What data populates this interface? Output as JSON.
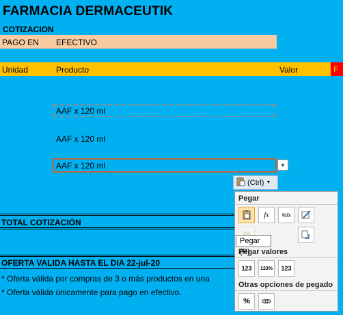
{
  "sheet": {
    "title": "FARMACIA DERMACEUTIK",
    "subtitle": "COTIZACION",
    "payment_label": "PAGO EN",
    "payment_value": "EFECTIVO",
    "headers": {
      "unit": "Unidad",
      "product": "Producto",
      "value": "Valor",
      "extra": "F"
    },
    "rows": [
      {
        "product": "AAF x 120 ml"
      },
      {
        "product": "AAF x 120 ml"
      },
      {
        "product": "AAF x 120 ml"
      }
    ],
    "total_label": "TOTAL COTIZACIÓN",
    "offer_label": "OFERTA VALIDA HASTA EL DIA 22-jul-20",
    "notes": [
      "* Oferta válida por compras de 3 o más productos en una",
      "* Oferta válida únicamente para pago en efectivo."
    ]
  },
  "paste_options": {
    "tag_label": "(Ctrl)",
    "section_paste": "Pegar",
    "section_values": "Pegar valores",
    "section_other": "Otras opciones de pegado",
    "tooltip": "Pegar (P)",
    "icons": {
      "formula": "fx",
      "percent_formula": "%fx",
      "values": "123",
      "values_percent": "123%",
      "values_format": "123"
    }
  },
  "colors": {
    "background": "#00b0f0",
    "header_band": "#ffc000",
    "payment_band": "#f8cba0",
    "accent_red": "#ff0000"
  }
}
